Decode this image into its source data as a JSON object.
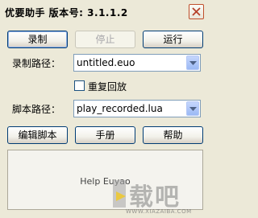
{
  "window": {
    "title": "优要助手  版本号: 3.1.1.2"
  },
  "toolbar": {
    "record_label": "录制",
    "stop_label": "停止",
    "run_label": "运行"
  },
  "record_path": {
    "label": "录制路径：",
    "value": "untitled.euo"
  },
  "repeat_play": {
    "label": "重复回放",
    "checked": false
  },
  "script_path": {
    "label": "脚本路径：",
    "value": "play_recorded.lua"
  },
  "actions": {
    "edit_label": "编辑脚本",
    "manual_label": "手册",
    "help_label": "帮助"
  },
  "help_panel": {
    "text": "Help Euyao"
  },
  "watermark": {
    "main": "载吧",
    "sub": "WWW.XIAZAIBA.COM"
  },
  "colors": {
    "window_bg": "#ECE9D8",
    "button_border": "#003C74",
    "close_border": "#C04F2C",
    "combo_border": "#7F9DB9"
  }
}
